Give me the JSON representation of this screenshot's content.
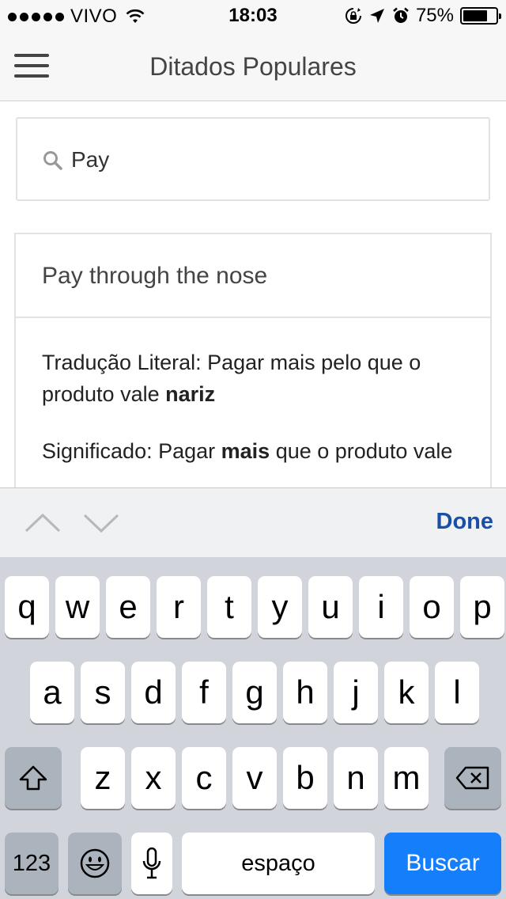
{
  "status_bar": {
    "carrier": "VIVO",
    "time": "18:03",
    "battery": "75%",
    "battery_level": 0.75,
    "icons": [
      "signal-dots-icon",
      "wifi-icon",
      "rotation-lock-icon",
      "location-arrow-icon",
      "alarm-icon",
      "battery-icon"
    ]
  },
  "nav": {
    "title": "Ditados Populares",
    "menu_icon": "hamburger-menu-icon"
  },
  "search": {
    "value": "Pay",
    "icon": "search-icon"
  },
  "result": {
    "phrase": "Pay through the nose",
    "literal_label": "Tradução Literal: ",
    "literal_text": "Pagar mais pelo que o produto vale ",
    "literal_bold": "nariz",
    "meaning_label": "Significado: ",
    "meaning_pre": "Pagar ",
    "meaning_bold": "mais",
    "meaning_post": " que o produto vale"
  },
  "accessory": {
    "done_label": "Done",
    "prev_icon": "chevron-up-icon",
    "next_icon": "chevron-down-icon",
    "done_color": "#1a4fa8"
  },
  "keyboard": {
    "row1": [
      "q",
      "w",
      "e",
      "r",
      "t",
      "y",
      "u",
      "i",
      "o",
      "p"
    ],
    "row2": [
      "a",
      "s",
      "d",
      "f",
      "g",
      "h",
      "j",
      "k",
      "l"
    ],
    "row3": [
      "z",
      "x",
      "c",
      "v",
      "b",
      "n",
      "m"
    ],
    "numbers_label": "123",
    "space_label": "espaço",
    "action_label": "Buscar",
    "action_color": "#147efb",
    "icons": [
      "shift-icon",
      "backspace-icon",
      "emoji-icon",
      "microphone-icon"
    ]
  }
}
